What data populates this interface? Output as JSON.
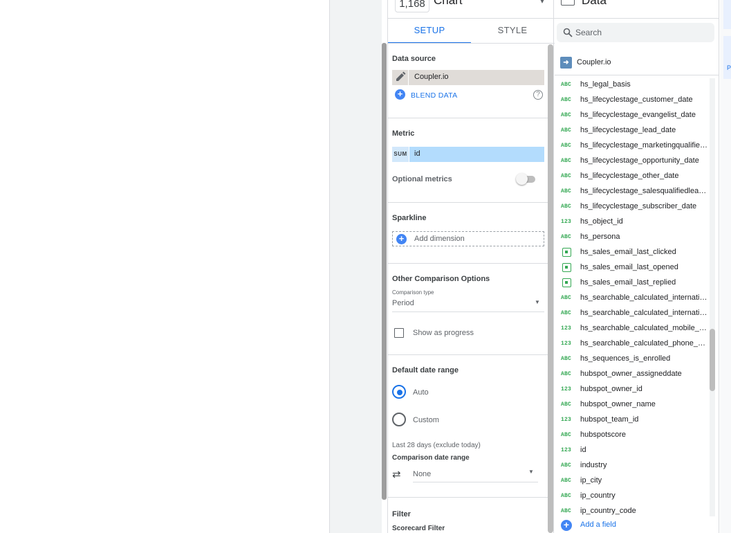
{
  "chart_panel": {
    "chart_id": "1,168",
    "title": "Chart",
    "tabs": [
      "SETUP",
      "STYLE"
    ],
    "active_tab": "SETUP"
  },
  "setup": {
    "data_source_title": "Data source",
    "data_source_name": "Coupler.io",
    "blend_label": "BLEND DATA",
    "help_glyph": "?",
    "metric_title": "Metric",
    "metric_aggregation": "SUM",
    "metric_field": "id",
    "optional_metrics_label": "Optional metrics",
    "optional_metrics_enabled": false,
    "sparkline_title": "Sparkline",
    "add_dimension_label": "Add dimension",
    "comparison_title": "Other Comparison Options",
    "comparison_type_label": "Comparison type",
    "comparison_type_value": "Period",
    "show_progress_label": "Show as progress",
    "show_progress_checked": false,
    "date_range_title": "Default date range",
    "date_range_options": [
      "Auto",
      "Custom"
    ],
    "date_range_selected": "Auto",
    "date_range_note": "Last 28 days (exclude today)",
    "comparison_range_label": "Comparison date range",
    "comparison_range_value": "None",
    "filter_title": "Filter",
    "scorecard_filter_title": "Scorecard Filter"
  },
  "data": {
    "title": "Data",
    "search_placeholder": "Search",
    "source_name": "Coupler.io",
    "add_field_label": "Add a field",
    "fields": [
      {
        "type": "ABC",
        "name": "hs_legal_basis"
      },
      {
        "type": "ABC",
        "name": "hs_lifecyclestage_customer_date"
      },
      {
        "type": "ABC",
        "name": "hs_lifecyclestage_evangelist_date"
      },
      {
        "type": "ABC",
        "name": "hs_lifecyclestage_lead_date"
      },
      {
        "type": "ABC",
        "name": "hs_lifecyclestage_marketingqualifie…"
      },
      {
        "type": "ABC",
        "name": "hs_lifecyclestage_opportunity_date"
      },
      {
        "type": "ABC",
        "name": "hs_lifecyclestage_other_date"
      },
      {
        "type": "ABC",
        "name": "hs_lifecyclestage_salesqualifiedlead…"
      },
      {
        "type": "ABC",
        "name": "hs_lifecyclestage_subscriber_date"
      },
      {
        "type": "123",
        "name": "hs_object_id"
      },
      {
        "type": "ABC",
        "name": "hs_persona"
      },
      {
        "type": "date",
        "name": "hs_sales_email_last_clicked"
      },
      {
        "type": "date",
        "name": "hs_sales_email_last_opened"
      },
      {
        "type": "date",
        "name": "hs_sales_email_last_replied"
      },
      {
        "type": "ABC",
        "name": "hs_searchable_calculated_internatio…"
      },
      {
        "type": "ABC",
        "name": "hs_searchable_calculated_internatio…"
      },
      {
        "type": "123",
        "name": "hs_searchable_calculated_mobile_n…"
      },
      {
        "type": "123",
        "name": "hs_searchable_calculated_phone_nu…"
      },
      {
        "type": "ABC",
        "name": "hs_sequences_is_enrolled"
      },
      {
        "type": "ABC",
        "name": "hubspot_owner_assigneddate"
      },
      {
        "type": "123",
        "name": "hubspot_owner_id"
      },
      {
        "type": "ABC",
        "name": "hubspot_owner_name"
      },
      {
        "type": "123",
        "name": "hubspot_team_id"
      },
      {
        "type": "ABC",
        "name": "hubspotscore"
      },
      {
        "type": "123",
        "name": "id"
      },
      {
        "type": "ABC",
        "name": "industry"
      },
      {
        "type": "ABC",
        "name": "ip_city"
      },
      {
        "type": "ABC",
        "name": "ip_country"
      },
      {
        "type": "ABC",
        "name": "ip_country_code"
      }
    ]
  },
  "right_edge": {
    "letter": "P"
  },
  "colors": {
    "accent": "#1a73e8",
    "metric_chip": "#b3dcfd",
    "data_source_chip": "#e0dcd8",
    "field_type": "#34a853"
  }
}
